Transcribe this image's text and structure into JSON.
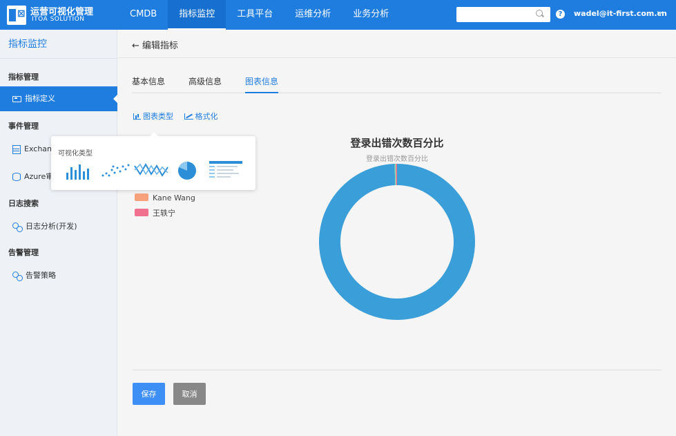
{
  "app": {
    "title": "运营可视化管理",
    "subtitle": "ITOA SOLUTION",
    "logo_letter": "E",
    "logo_mark": "⊠"
  },
  "nav": {
    "items": [
      "CMDB",
      "指标监控",
      "工具平台",
      "运维分析",
      "业务分析"
    ],
    "active": 1
  },
  "search": {
    "value": "",
    "placeholder": ""
  },
  "user": {
    "email": "wadel@it-first.com.cn"
  },
  "sidebar": {
    "title": "指标监控",
    "groups": [
      {
        "label": "指标管理",
        "items": [
          {
            "label": "指标定义",
            "icon": "card-icon",
            "active": true
          }
        ]
      },
      {
        "label": "事件管理",
        "items": [
          {
            "label": "Exchange",
            "icon": "server-icon"
          },
          {
            "label": "Azure审",
            "icon": "database-icon"
          }
        ]
      },
      {
        "label": "日志搜索",
        "items": [
          {
            "label": "日志分析(开发)",
            "icon": "link-icon"
          }
        ]
      },
      {
        "label": "告警管理",
        "items": [
          {
            "label": "告警策略",
            "icon": "link-icon"
          }
        ]
      }
    ]
  },
  "page": {
    "back_label": "编辑指标",
    "tabs": [
      "基本信息",
      "高级信息",
      "图表信息"
    ],
    "active_tab": 2,
    "subtabs": [
      "图表类型",
      "格式化"
    ],
    "popover": {
      "title": "可视化类型",
      "types": [
        "bar-chart-icon",
        "scatter-chart-icon",
        "line-chart-icon",
        "pie-chart-icon",
        "table-icon"
      ]
    },
    "save_label": "保存",
    "cancel_label": "取消"
  },
  "colors": {
    "primary": "#1f7de0",
    "donut": "#3a9fd8"
  },
  "chart_data": {
    "type": "pie",
    "title": "登录出错次数百分比",
    "subtitle": "登录出错次数百分比",
    "legend": [
      {
        "name": "Kane Wang",
        "color": "#f7a17c"
      },
      {
        "name": "王轶宁",
        "color": "#f07090"
      }
    ],
    "slices": [
      {
        "value": 99.5,
        "color": "#3a9fd8"
      },
      {
        "value": 0.25,
        "color": "#8fd8a8"
      },
      {
        "value": 0.25,
        "color": "#f07090"
      }
    ]
  }
}
